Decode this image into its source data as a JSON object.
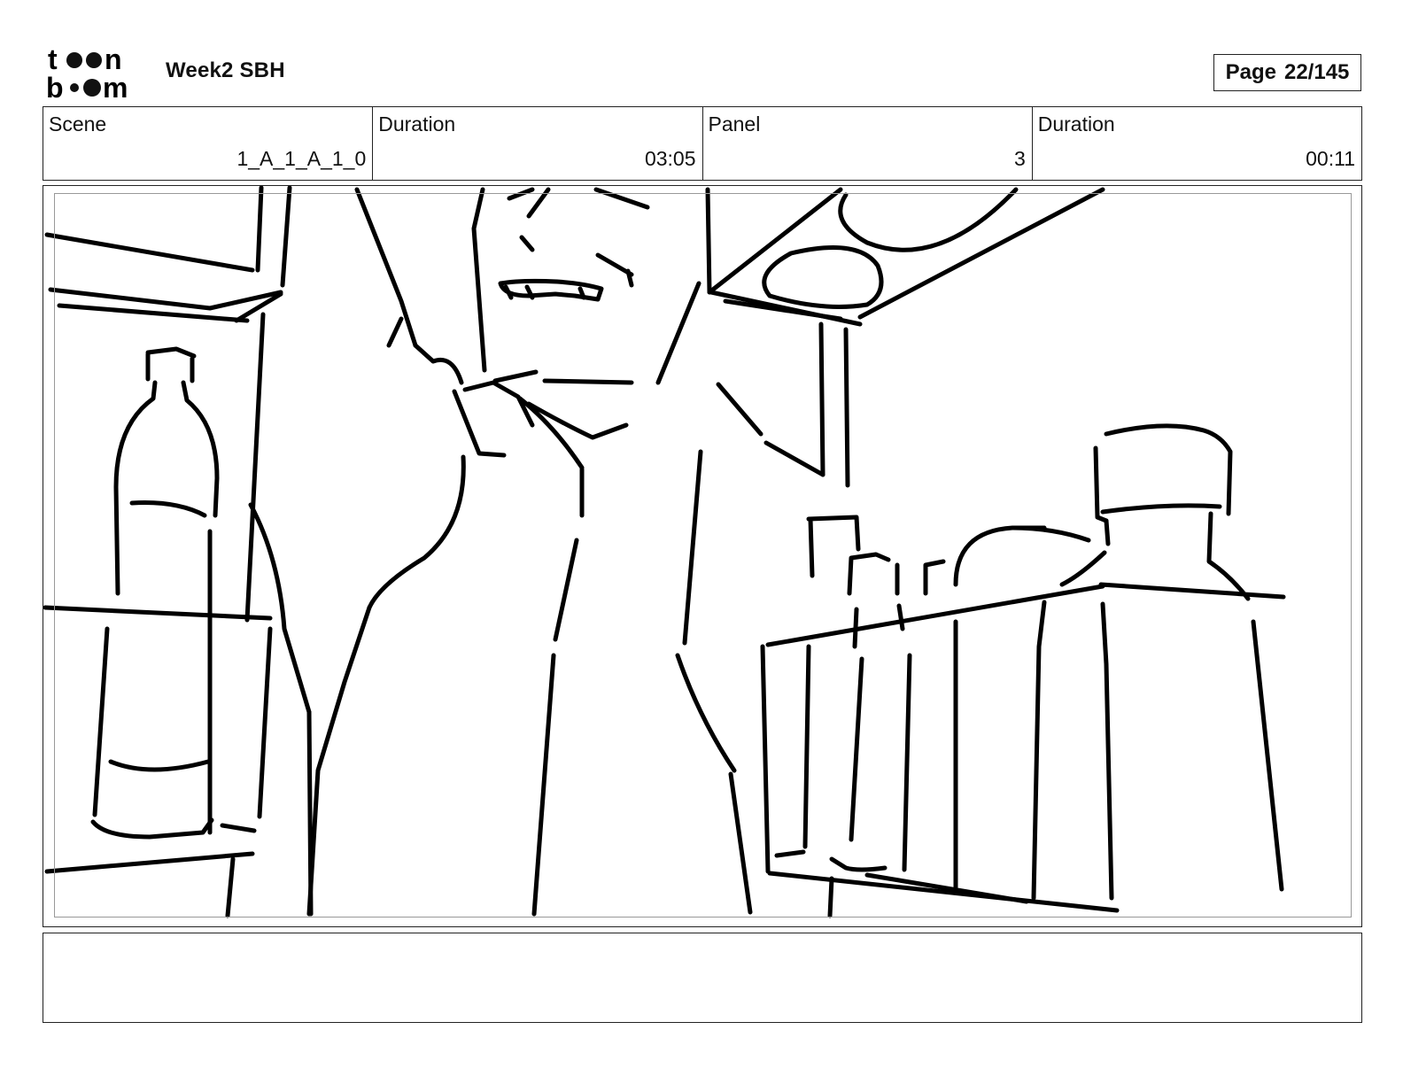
{
  "header": {
    "logo_text": "toon boom",
    "project_title": "Week2 SBH",
    "page_label": "Page",
    "page_number": "22/145"
  },
  "info": {
    "scene_label": "Scene",
    "scene_value": "1_A_1_A_1_0",
    "scene_duration_label": "Duration",
    "scene_duration_value": "03:05",
    "panel_label": "Panel",
    "panel_value": "3",
    "panel_duration_label": "Duration",
    "panel_duration_value": "00:11"
  },
  "notes": {
    "dialogue": ""
  }
}
